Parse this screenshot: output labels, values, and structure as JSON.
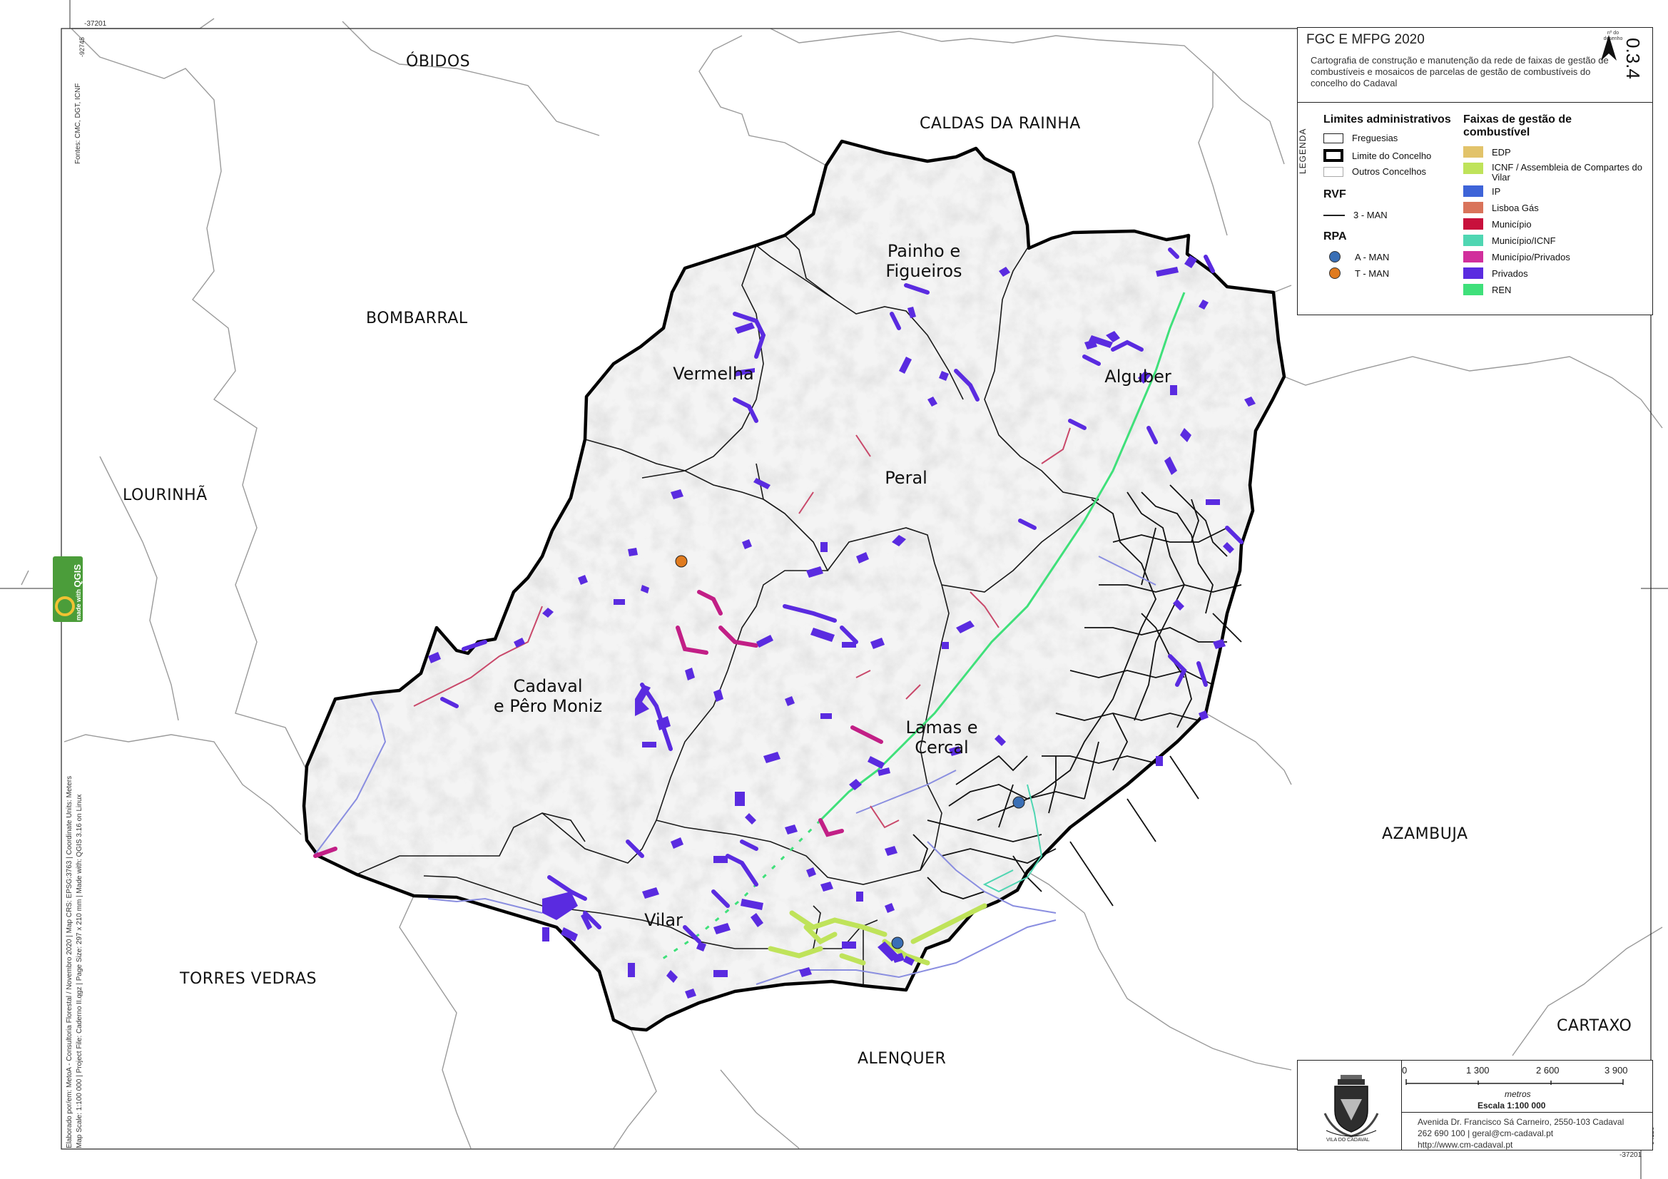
{
  "map": {
    "neighbours": {
      "obidos": "ÓBIDOS",
      "caldas": "CALDAS DA RAINHA",
      "bombarral": "BOMBARRAL",
      "lourinha": "LOURINHÃ",
      "torres_vedras": "TORRES VEDRAS",
      "alenquer": "ALENQUER",
      "azambuja": "AZAMBUJA",
      "cartaxo": "CARTAXO"
    },
    "parishes": {
      "painho": [
        "Painho e",
        "Figueiros"
      ],
      "vermelha": "Vermelha",
      "alguber": "Alguber",
      "peral": "Peral",
      "cadaval": [
        "Cadaval",
        "e Pêro Moniz"
      ],
      "lamas": [
        "Lamas e",
        "Cercal"
      ],
      "vilar": "Vilar"
    },
    "grid_ticks": {
      "top_left": "-37201",
      "top_left_v": "-92745",
      "bottom_right_v": "-94126",
      "bottom_right": "-37201"
    },
    "sources_text": "Fontes: CMC, DGT, ICNF",
    "credits_text": "Elaborado por/em: MetoA - Consultoria Florestal / Novembro 2020 | Map CRS: EPSG:3763 | Coordinate Units: Meters",
    "credits_text2": "Map Scale: 1:100 000 | Project File: Caderno II.qgz | Page Size: 297 x 210 mm | Made with: QGIS 3.16 on Linux",
    "qgis_badge": [
      "made",
      "with",
      "QGIS"
    ]
  },
  "legend": {
    "title": "FGC E MFPG 2020",
    "description": "Cartografia de construção e manutenção da rede de faixas de gestão de combustíveis e mosaicos de parcelas de gestão de combustíveis do concelho do Cadaval",
    "side_label": "LEGENDA",
    "map_number": "0.3.4",
    "map_number_label": "nº do desenho",
    "admin_header": "Limites administrativos",
    "admin_items": [
      "Freguesias",
      "Limite do Concelho",
      "Outros Concelhos"
    ],
    "rvf_header": "RVF",
    "rvf_items": [
      "3 - MAN"
    ],
    "rpa_header": "RPA",
    "rpa_items": [
      {
        "label": "A - MAN",
        "color": "#3a6fb5"
      },
      {
        "label": "T - MAN",
        "color": "#e07b1f"
      }
    ],
    "faixas_header": "Faixas de gestão de combustível",
    "faixas_items": [
      {
        "label": "EDP",
        "color": "#e2c36a"
      },
      {
        "label": "ICNF / Assembleia de Compartes do Vilar",
        "color": "#bfe35a"
      },
      {
        "label": "IP",
        "color": "#3e64d8"
      },
      {
        "label": "Lisboa Gás",
        "color": "#d9735a"
      },
      {
        "label": "Município",
        "color": "#c8103c"
      },
      {
        "label": "Município/ICNF",
        "color": "#4fd6b2"
      },
      {
        "label": "Município/Privados",
        "color": "#d12f9c"
      },
      {
        "label": "Privados",
        "color": "#5a2be0"
      },
      {
        "label": "REN",
        "color": "#3fe07a"
      }
    ]
  },
  "scale": {
    "ticks": [
      "0",
      "1 300",
      "2 600",
      "3 900"
    ],
    "unit": "metros",
    "label": "Escala 1:100 000",
    "address": "Avenida Dr. Francisco Sá Carneiro, 2550-103 Cadaval",
    "contacts": "262 690 100 | geral@cm-cadaval.pt",
    "web": "http://www.cm-cadaval.pt",
    "crest_text": "VILA DO CADAVAL"
  }
}
